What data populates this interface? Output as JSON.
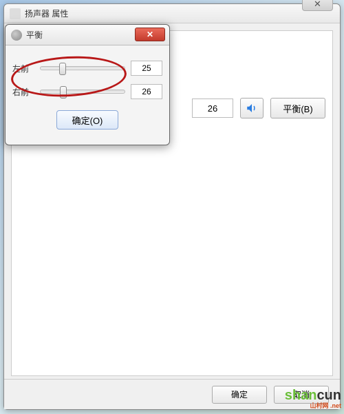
{
  "main_window": {
    "title": "扬声器 属性",
    "close_glyph": "✕",
    "value": "26",
    "balance_button": "平衡(B)",
    "ok_button": "确定",
    "cancel_button": "取消"
  },
  "balance_dialog": {
    "title": "平衡",
    "close_glyph": "✕",
    "rows": [
      {
        "label": "左前",
        "value": "25"
      },
      {
        "label": "右前",
        "value": "26"
      }
    ],
    "ok_button": "确定(O)"
  },
  "watermark": {
    "brand_green": "shan",
    "brand_dark": "cun",
    "sub": "山村网 .net"
  },
  "colors": {
    "close_red": "#c33a2c",
    "highlight_red": "#b81818",
    "sound_blue": "#2a7de1"
  }
}
